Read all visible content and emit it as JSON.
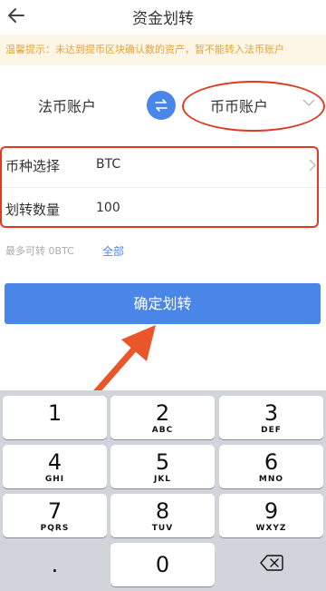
{
  "header": {
    "title": "资金划转"
  },
  "notice": {
    "text": "温馨提示：未达到提币区块确认数的资产，暂不能转入法币账户"
  },
  "accounts": {
    "from": "法币账户",
    "to": "币币账户"
  },
  "form": {
    "currency_label": "币种选择",
    "currency_value": "BTC",
    "amount_label": "划转数量",
    "amount_value": "100"
  },
  "max": {
    "text": "最多可转 0BTC",
    "all_label": "全部"
  },
  "confirm": {
    "label": "确定划转"
  },
  "keyboard": {
    "keys": [
      {
        "digit": "1",
        "letters": ""
      },
      {
        "digit": "2",
        "letters": "ABC"
      },
      {
        "digit": "3",
        "letters": "DEF"
      },
      {
        "digit": "4",
        "letters": "GHI"
      },
      {
        "digit": "5",
        "letters": "JKL"
      },
      {
        "digit": "6",
        "letters": "MNO"
      },
      {
        "digit": "7",
        "letters": "PQRS"
      },
      {
        "digit": "8",
        "letters": "TUV"
      },
      {
        "digit": "9",
        "letters": "WXYZ"
      }
    ],
    "dot": ".",
    "zero": "0"
  },
  "colors": {
    "accent": "#4a86e8",
    "annotation": "#e03b1f",
    "notice_text": "#e6a23c",
    "notice_bg": "#fdf6e6"
  },
  "icons": {
    "back": "arrow-left-icon",
    "swap": "swap-arrows-icon",
    "chevron": "chevron-down-icon",
    "row_chevron": "chevron-right-icon",
    "backspace": "backspace-icon"
  }
}
